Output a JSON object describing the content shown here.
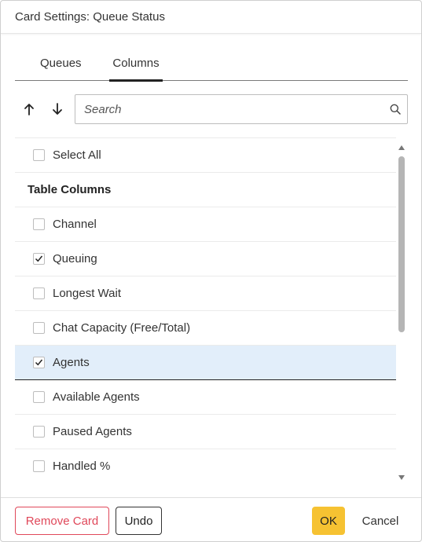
{
  "dialog": {
    "title": "Card Settings: Queue Status"
  },
  "tabs": [
    {
      "label": "Queues",
      "active": false
    },
    {
      "label": "Columns",
      "active": true
    }
  ],
  "toolbar": {
    "move_up_icon": "arrow-up-icon",
    "move_down_icon": "arrow-down-icon"
  },
  "search": {
    "placeholder": "Search",
    "value": "",
    "icon": "search-icon"
  },
  "list": {
    "select_all": {
      "label": "Select All",
      "checked": false
    },
    "section_title": "Table Columns",
    "items": [
      {
        "label": "Channel",
        "checked": false,
        "selected": false
      },
      {
        "label": "Queuing",
        "checked": true,
        "selected": false
      },
      {
        "label": "Longest Wait",
        "checked": false,
        "selected": false
      },
      {
        "label": "Chat Capacity (Free/Total)",
        "checked": false,
        "selected": false
      },
      {
        "label": "Agents",
        "checked": true,
        "selected": true
      },
      {
        "label": "Available Agents",
        "checked": false,
        "selected": false
      },
      {
        "label": "Paused Agents",
        "checked": false,
        "selected": false
      },
      {
        "label": "Handled %",
        "checked": false,
        "selected": false
      }
    ]
  },
  "footer": {
    "remove_label": "Remove Card",
    "undo_label": "Undo",
    "ok_label": "OK",
    "cancel_label": "Cancel"
  },
  "colors": {
    "accent": "#f6c232",
    "danger": "#e0485a",
    "selected_row": "#e2eefa"
  }
}
